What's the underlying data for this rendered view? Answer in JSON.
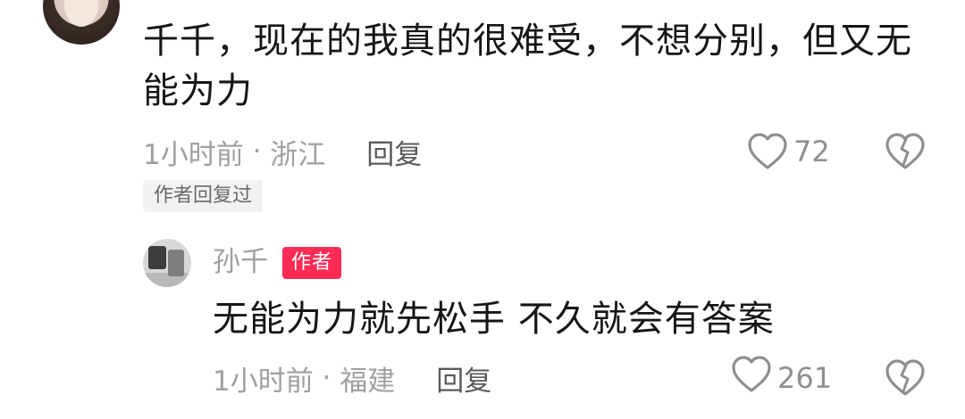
{
  "comment": {
    "text": "千千，现在的我真的很难受，不想分别，但又无能为力",
    "time": "1小时前",
    "separator": " · ",
    "location": "浙江",
    "reply_label": "回复",
    "like_count": "72",
    "author_replied_tag": "作者回复过"
  },
  "reply": {
    "user_name": "孙千",
    "author_badge": "作者",
    "text": "无能为力就先松手 不久就会有答案",
    "time": "1小时前",
    "separator": " · ",
    "location": "福建",
    "reply_label": "回复",
    "like_count": "261"
  },
  "icons": {
    "like": "heart-outline-icon",
    "dislike": "broken-heart-icon"
  },
  "colors": {
    "author_badge_bg": "#fe2c55",
    "meta_text": "#a0a0a0",
    "icon": "#8f8f8f"
  }
}
